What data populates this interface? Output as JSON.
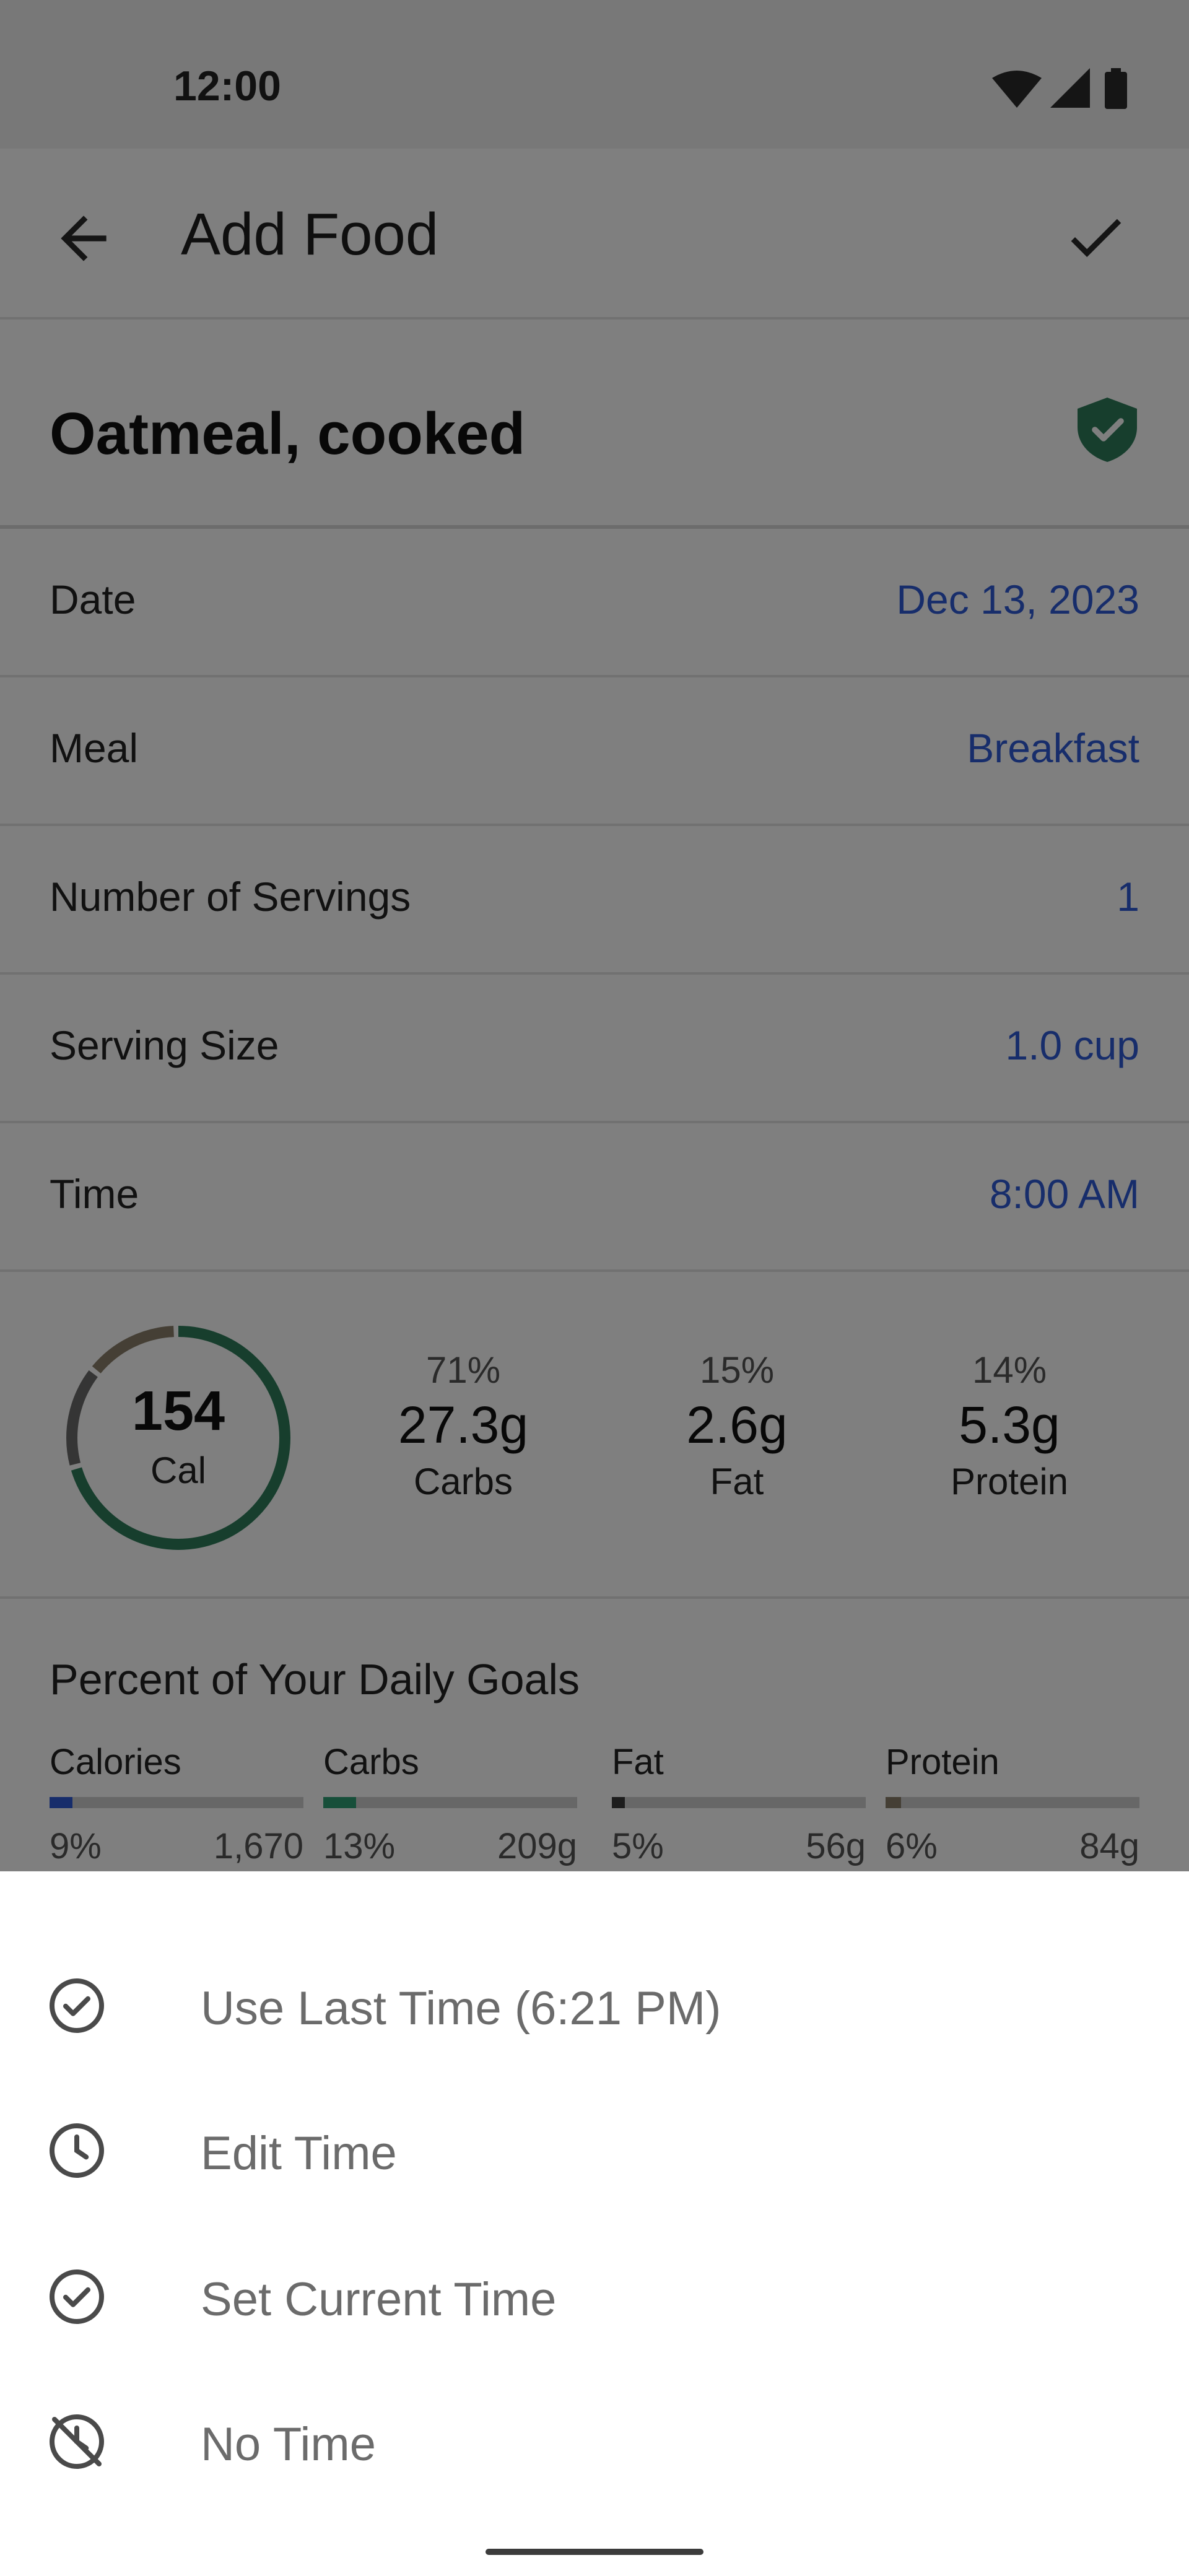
{
  "status_bar": {
    "time": "12:00"
  },
  "app_bar": {
    "title": "Add Food"
  },
  "food": {
    "name": "Oatmeal, cooked"
  },
  "form_rows": [
    {
      "label": "Date",
      "value": "Dec 13, 2023"
    },
    {
      "label": "Meal",
      "value": "Breakfast"
    },
    {
      "label": "Number of Servings",
      "value": "1"
    },
    {
      "label": "Serving Size",
      "value": "1.0 cup"
    },
    {
      "label": "Time",
      "value": "8:00 AM"
    }
  ],
  "nutrition": {
    "calories": "154",
    "calories_label": "Cal",
    "macros": [
      {
        "percent": "71%",
        "grams": "27.3g",
        "label": "Carbs",
        "share": 0.71,
        "color": "#2e7d5b"
      },
      {
        "percent": "15%",
        "grams": "2.6g",
        "label": "Fat",
        "share": 0.15,
        "color": "#6b6b6b"
      },
      {
        "percent": "14%",
        "grams": "5.3g",
        "label": "Protein",
        "share": 0.14,
        "color": "#8a7f6a"
      }
    ]
  },
  "daily_goals": {
    "title": "Percent of Your Daily Goals",
    "items": [
      {
        "label": "Calories",
        "percent": "9%",
        "target": "1,670",
        "fraction": 0.09,
        "color": "#2f5bd6"
      },
      {
        "label": "Carbs",
        "percent": "13%",
        "target": "209g",
        "fraction": 0.13,
        "color": "#2e9e74"
      },
      {
        "label": "Fat",
        "percent": "5%",
        "target": "56g",
        "fraction": 0.05,
        "color": "#3a3a3a"
      },
      {
        "label": "Protein",
        "percent": "6%",
        "target": "84g",
        "fraction": 0.06,
        "color": "#8a7f6a"
      }
    ]
  },
  "time_sheet": {
    "options": [
      {
        "label": "Use Last Time (6:21 PM)",
        "icon": "check-circle-icon"
      },
      {
        "label": "Edit Time",
        "icon": "clock-icon"
      },
      {
        "label": "Set Current Time",
        "icon": "check-circle-icon"
      },
      {
        "label": "No Time",
        "icon": "clock-off-icon"
      }
    ]
  },
  "colors": {
    "accent_link": "#2f5bd6",
    "verified_badge": "#2e7d5b",
    "sheet_text": "#6b6b6b"
  }
}
